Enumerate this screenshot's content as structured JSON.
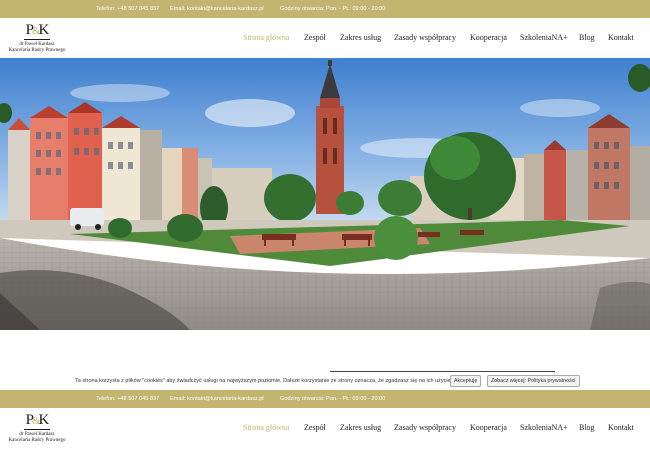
{
  "topbar": {
    "phone": "Telefon: +48 507 045 837",
    "email": "Email: kontakt@kancelaria-kardasz.pl",
    "hours": "Godziny otwarcia: Pon. - Pt.: 09:00 - 20:00"
  },
  "logo": {
    "mark_left": "P",
    "mark_amp": "&",
    "mark_right": "K",
    "line1": "dr Paweł Kardasz",
    "line2": "Kancelaria Radcy Prawnego"
  },
  "nav": {
    "items": [
      {
        "label": "Strona główna",
        "active": true
      },
      {
        "label": "Zespół"
      },
      {
        "label": "Zakres usług"
      },
      {
        "label": "Zasady współpracy"
      },
      {
        "label": "Kooperacja"
      },
      {
        "label": "SzkoleniaNA+"
      },
      {
        "label": "Blog"
      },
      {
        "label": "Kontakt"
      }
    ]
  },
  "cookie": {
    "message": "Ta strona korzysta z plików \"cookies\" aby świadczyć usługi na najwyższym poziomie. Dalsze korzystanie ze strony oznacza, że zgadzasz się na ich użycie.",
    "accept_label": "Akceptuję",
    "privacy_label": "Zobacz więcej: Polityka prywatności"
  },
  "colors": {
    "accent": "#c3b46f",
    "nav_text": "#222222"
  },
  "hero": {
    "image": "panorama-of-old-town-square-with-brick-church-tower"
  }
}
